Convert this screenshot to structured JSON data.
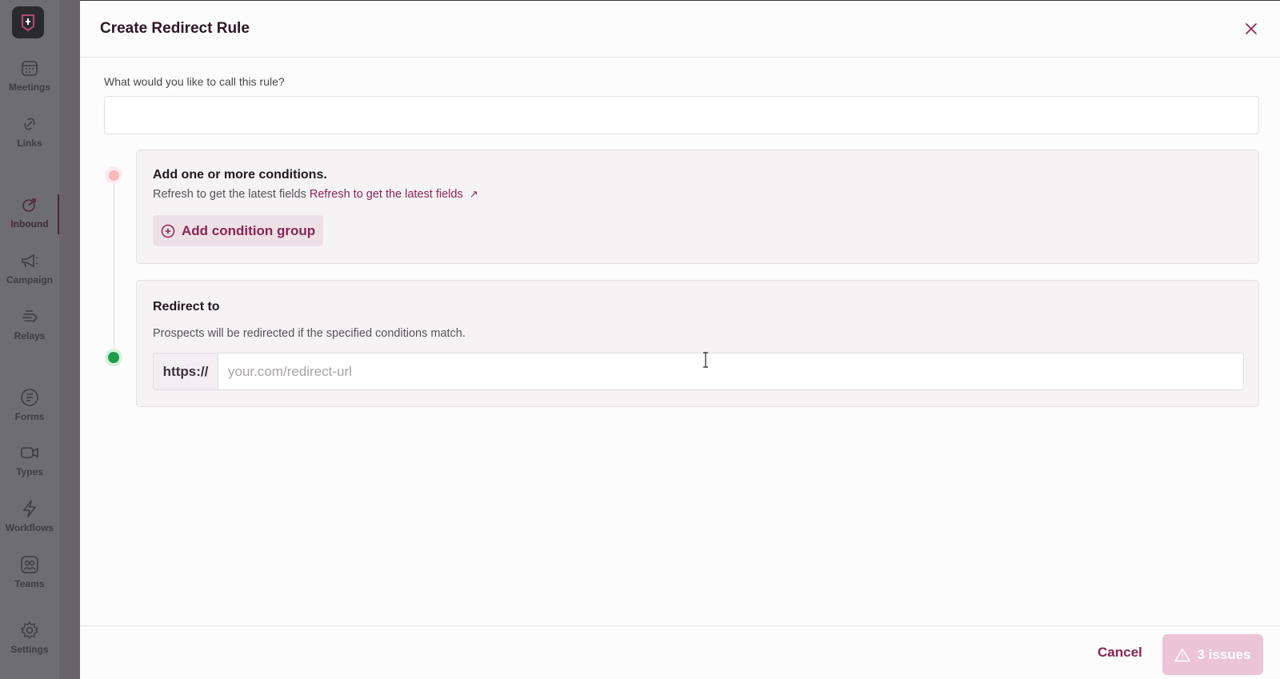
{
  "sidebar": {
    "logo": "app-logo",
    "items": [
      {
        "label": "Meetings",
        "icon": "calendar-icon"
      },
      {
        "label": "Links",
        "icon": "link-icon"
      },
      {
        "label": "Inbound",
        "icon": "inbound-icon",
        "active": true
      },
      {
        "label": "Campaign",
        "icon": "megaphone-icon"
      },
      {
        "label": "Relays",
        "icon": "hand-icon"
      },
      {
        "label": "Forms",
        "icon": "form-icon"
      },
      {
        "label": "Types",
        "icon": "video-icon"
      },
      {
        "label": "Workflows",
        "icon": "lightning-icon"
      },
      {
        "label": "Teams",
        "icon": "team-icon"
      },
      {
        "label": "Settings",
        "icon": "gear-icon"
      }
    ]
  },
  "modal": {
    "title": "Create Redirect Rule",
    "name_field": {
      "label": "What would you like to call this rule?",
      "value": "",
      "placeholder": ""
    },
    "conditions": {
      "title": "Add one or more conditions.",
      "subtitle_text": "Refresh to get the latest fields",
      "refresh_link": "Refresh to get the latest fields",
      "link_arrow": "↗",
      "add_group_label": "Add condition group"
    },
    "redirect": {
      "title": "Redirect to",
      "subtitle": "Prospects will be redirected if the specified conditions match.",
      "prefix": "https://",
      "url_value": "",
      "url_placeholder": "your.com/redirect-url"
    },
    "footer": {
      "cancel_label": "Cancel",
      "issues_label": "3 issues"
    }
  },
  "colors": {
    "accent": "#8a2455",
    "step_pending": "#f6b9bd",
    "step_done": "#1f9d4a",
    "issues_button_bg": "#ebc4d5"
  }
}
